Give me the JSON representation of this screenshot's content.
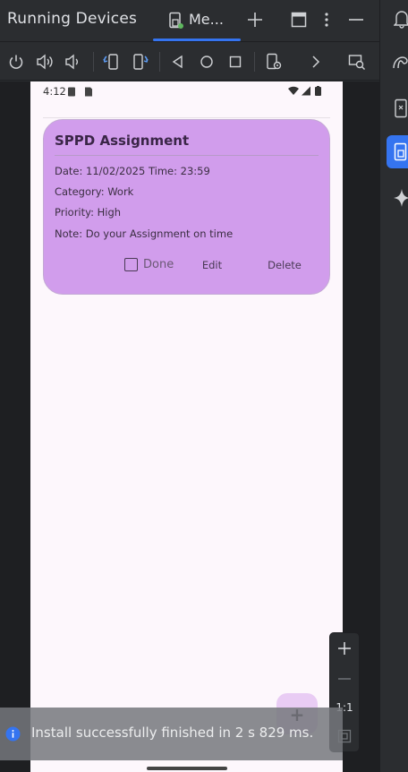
{
  "panel": {
    "title": "Running Devices"
  },
  "tab": {
    "label": "Me..."
  },
  "device": {
    "status_time": "4:12"
  },
  "card": {
    "title": "SPPD Assignment",
    "date_line": "Date: 11/02/2025  Time: 23:59",
    "category_line": "Category: Work",
    "priority_line": "Priority: High",
    "note_line": "Note: Do your Assignment on time",
    "done_label": "Done",
    "done_checked": false,
    "edit_label": "Edit",
    "delete_label": "Delete"
  },
  "fab": {
    "label": "+"
  },
  "zoom": {
    "ratio_label": "1:1"
  },
  "notification": {
    "text": "Install successfully finished in 2 s 829 ms."
  },
  "colors": {
    "accent": "#3574f0",
    "card": "#d19dec",
    "fab": "#e9ccf4",
    "ide_bg": "#2b2d30"
  }
}
